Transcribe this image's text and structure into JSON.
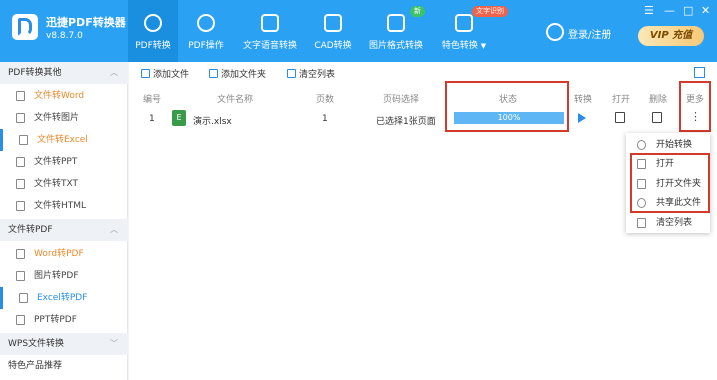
{
  "app": {
    "name": "迅捷PDF转换器",
    "version": "v8.8.7.0"
  },
  "nav": [
    {
      "label": "PDF转换",
      "icon": "pdf-convert-icon",
      "active": true
    },
    {
      "label": "PDF操作",
      "icon": "pdf-operate-icon"
    },
    {
      "label": "文字语音转换",
      "icon": "text-voice-icon"
    },
    {
      "label": "CAD转换",
      "icon": "cad-icon"
    },
    {
      "label": "图片格式转换",
      "icon": "image-format-icon",
      "badge": "新"
    },
    {
      "label": "特色转换",
      "icon": "special-convert-icon",
      "badge": "文字识别",
      "dropdown": "▼"
    }
  ],
  "header": {
    "login": "登录/注册",
    "vip": "VIP 充值",
    "window": {
      "menu": "☰",
      "minimize": "—",
      "maximize": "□",
      "close": "✕"
    }
  },
  "sidebar": {
    "sections": [
      {
        "title": "PDF转换其他",
        "chevron": "︿",
        "items": [
          "文件转Word",
          "文件转图片",
          "文件转Excel",
          "文件转PPT",
          "文件转TXT",
          "文件转HTML"
        ]
      },
      {
        "title": "文件转PDF",
        "chevron": "︿",
        "items": [
          "Word转PDF",
          "图片转PDF",
          "Excel转PDF",
          "PPT转PDF"
        ]
      },
      {
        "title": "WPS文件转换",
        "chevron": "﹀",
        "items": []
      }
    ],
    "recommend": "特色产品推荐"
  },
  "toolbar": {
    "add_file": "添加文件",
    "add_folder": "添加文件夹",
    "clear_list": "清空列表"
  },
  "table": {
    "headers": [
      "编号",
      "文件名称",
      "页数",
      "页码选择",
      "状态",
      "转换",
      "打开",
      "删除",
      "更多"
    ],
    "rows": [
      {
        "index": "1",
        "file_icon": "E",
        "filename": "演示.xlsx",
        "pages": "1",
        "page_select": "已选择1张页面",
        "progress": "100%",
        "progress_value": 1.0
      }
    ]
  },
  "more_menu": [
    "开始转换",
    "打开",
    "打开文件夹",
    "共享此文件",
    "清空列表"
  ],
  "colors": {
    "header": "#2aa1f2",
    "accent": "#2a8de6",
    "highlight_box": "#d33a2c",
    "orange": "#e98a2c"
  }
}
